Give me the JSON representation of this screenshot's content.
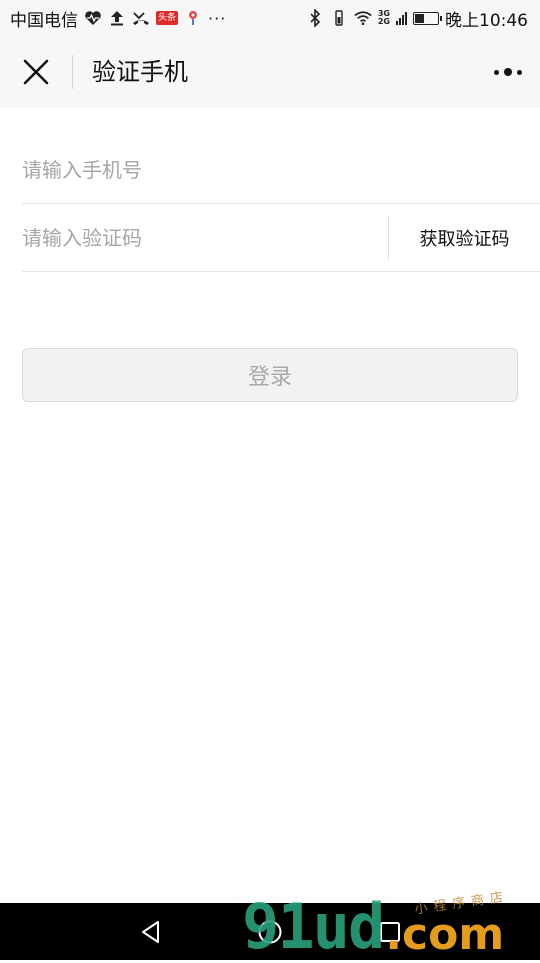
{
  "status_bar": {
    "carrier": "中国电信",
    "notification_badge": "头条",
    "more_indicator": "···",
    "network_top": "3G",
    "network_bottom": "2G",
    "battery_level": 0.45,
    "time": "晚上10:46"
  },
  "nav": {
    "title": "验证手机",
    "close_icon": "close-icon",
    "more_icon": "more-dots-icon"
  },
  "form": {
    "phone_placeholder": "请输入手机号",
    "phone_value": "",
    "code_placeholder": "请输入验证码",
    "code_value": "",
    "get_code_label": "获取验证码",
    "login_label": "登录"
  },
  "watermark": {
    "text": "91ud",
    "suffix": ".com",
    "script": "小程序商店"
  },
  "colors": {
    "nav_bg": "#f7f7f8",
    "placeholder": "#a6a6a6",
    "button_disabled_bg": "#f2f2f2",
    "button_disabled_text": "#a9a9a9",
    "watermark_green": "#2aa07c",
    "watermark_orange": "#e49c1c"
  }
}
